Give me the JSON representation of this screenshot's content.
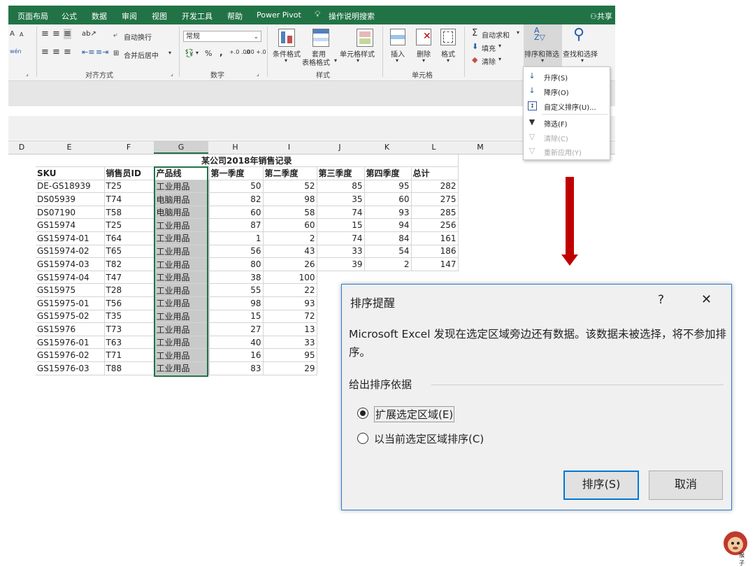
{
  "menubar": {
    "tabs": [
      "页面布局",
      "公式",
      "数据",
      "审阅",
      "视图",
      "开发工具",
      "帮助",
      "Power Pivot",
      "操作说明搜索"
    ],
    "share": "共享"
  },
  "ribbon": {
    "wrap_text": "自动换行",
    "merge_center": "合并后居中",
    "number_format": "常规",
    "percent": "%",
    "comma": ",",
    "dec_inc": "+.0 .00",
    "dec_dec": ".00 +.0",
    "conditional_format": "条件格式",
    "table_format_1": "套用",
    "table_format_2": "表格格式",
    "cell_styles": "单元格样式",
    "insert": "插入",
    "delete": "删除",
    "format": "格式",
    "autosum": "自动求和",
    "fill": "填充",
    "clear": "清除",
    "sort_filter": "排序和筛选",
    "find_select": "查找和选择",
    "groups": {
      "alignment": "对齐方式",
      "number": "数字",
      "styles": "样式",
      "cells": "单元格"
    },
    "font_size_inc": "A",
    "font_size_dec": "A",
    "phonetic": "wén"
  },
  "dropdown": {
    "items": [
      {
        "label": "升序(S)",
        "enabled": true,
        "icon": "sort-ascending-icon"
      },
      {
        "label": "降序(O)",
        "enabled": true,
        "icon": "sort-descending-icon"
      },
      {
        "label": "自定义排序(U)...",
        "enabled": true,
        "icon": "custom-sort-icon"
      },
      {
        "label": "筛选(F)",
        "enabled": true,
        "icon": "filter-icon"
      },
      {
        "label": "清除(C)",
        "enabled": false,
        "icon": "clear-filter-icon"
      },
      {
        "label": "重新应用(Y)",
        "enabled": false,
        "icon": "reapply-icon"
      }
    ]
  },
  "columns": [
    "D",
    "E",
    "F",
    "G",
    "H",
    "I",
    "J",
    "K",
    "L",
    "M"
  ],
  "sheet": {
    "title": "某公司2018年销售记录",
    "headers": [
      "SKU",
      "销售员ID",
      "产品线",
      "第一季度",
      "第二季度",
      "第三季度",
      "第四季度",
      "总计"
    ],
    "rows": [
      [
        "DE-GS18939",
        "T25",
        "工业用品",
        "50",
        "52",
        "85",
        "95",
        "282"
      ],
      [
        "DS05939",
        "T74",
        "电脑用品",
        "82",
        "98",
        "35",
        "60",
        "275"
      ],
      [
        "DS07190",
        "T58",
        "电脑用品",
        "60",
        "58",
        "74",
        "93",
        "285"
      ],
      [
        "GS15974",
        "T25",
        "工业用品",
        "87",
        "60",
        "15",
        "94",
        "256"
      ],
      [
        "GS15974-01",
        "T64",
        "工业用品",
        "1",
        "2",
        "74",
        "84",
        "161"
      ],
      [
        "GS15974-02",
        "T65",
        "工业用品",
        "56",
        "43",
        "33",
        "54",
        "186"
      ],
      [
        "GS15974-03",
        "T82",
        "工业用品",
        "80",
        "26",
        "39",
        "2",
        "147"
      ],
      [
        "GS15974-04",
        "T47",
        "工业用品",
        "38",
        "100",
        "",
        "",
        ""
      ],
      [
        "GS15975",
        "T28",
        "工业用品",
        "55",
        "22",
        "",
        "",
        ""
      ],
      [
        "GS15975-01",
        "T56",
        "工业用品",
        "98",
        "93",
        "",
        "",
        ""
      ],
      [
        "GS15975-02",
        "T35",
        "工业用品",
        "15",
        "72",
        "",
        "",
        ""
      ],
      [
        "GS15976",
        "T73",
        "工业用品",
        "27",
        "13",
        "",
        "",
        ""
      ],
      [
        "GS15976-01",
        "T63",
        "工业用品",
        "40",
        "33",
        "",
        "",
        ""
      ],
      [
        "GS15976-02",
        "T71",
        "工业用品",
        "16",
        "95",
        "",
        "",
        ""
      ],
      [
        "GS15976-03",
        "T88",
        "工业用品",
        "83",
        "29",
        "",
        "",
        ""
      ]
    ]
  },
  "dialog": {
    "title": "排序提醒",
    "help": "?",
    "close": "✕",
    "message": "Microsoft Excel 发现在选定区域旁边还有数据。该数据未被选择，将不参加排序。",
    "section": "给出排序依据",
    "options": [
      {
        "label": "扩展选定区域(E)",
        "checked": true
      },
      {
        "label": "以当前选定区域排序(C)",
        "checked": false
      }
    ],
    "ok": "排序(S)",
    "cancel": "取消"
  },
  "logo_text": "猴子",
  "colors": {
    "excel_green": "#217346",
    "arrow": "#c00000",
    "dialog_border": "#2b7bd6"
  }
}
